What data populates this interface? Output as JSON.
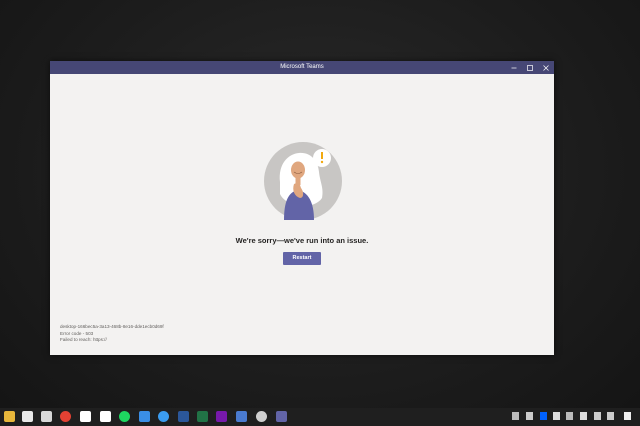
{
  "window": {
    "title": "Microsoft Teams",
    "controls": [
      "minimize",
      "maximize",
      "close"
    ]
  },
  "error": {
    "message": "We're sorry—we've run into an issue.",
    "button_label": "Restart",
    "illustration": "woman-thinking-exclamation",
    "diagnostics": [
      "desktop-166bec5a-3a13-468b-8e16-dde1ecb0d69f",
      "Error code - 503",
      "Failed to reach: https://"
    ]
  },
  "colors": {
    "teams_purple": "#6264a7",
    "titlebar": "#464775",
    "background": "#f3f2f1"
  },
  "taskbar": {
    "icons": [
      "file-explorer-icon",
      "store-icon",
      "mail-icon",
      "chrome-icon",
      "app-c-icon",
      "app-n-icon",
      "spotify-icon",
      "edit-icon",
      "cortana-icon",
      "word-icon",
      "excel-icon",
      "onenote-icon",
      "app-window-icon",
      "settings-icon",
      "teams-icon"
    ],
    "tray_icons": [
      "chevron-up-icon",
      "onedrive-icon",
      "dropbox-icon",
      "cloud-icon",
      "headphones-icon",
      "battery-icon",
      "network-icon",
      "volume-icon",
      "notification-icon"
    ]
  }
}
